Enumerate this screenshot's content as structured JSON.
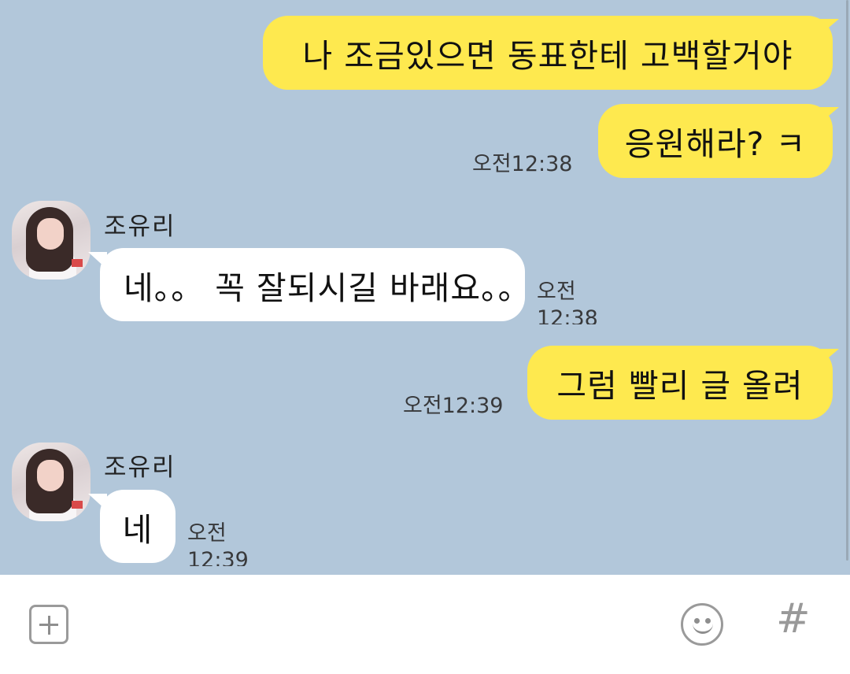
{
  "messages": [
    {
      "id": "m1",
      "from": "me",
      "text": "나 조금있으면 동표한테 고백할거야",
      "time": ""
    },
    {
      "id": "m2",
      "from": "me",
      "text": "응원해라? ㅋ",
      "time": "오전12:38"
    },
    {
      "id": "m3",
      "from": "other",
      "sender": "조유리",
      "text": "네。。 꼭 잘되시길 바래요。。",
      "time": "오전 12:38"
    },
    {
      "id": "m4",
      "from": "me",
      "text": "그럼 빨리 글 올려",
      "time": "오전12:39"
    },
    {
      "id": "m5",
      "from": "other",
      "sender": "조유리",
      "text": "네",
      "time": "오전 12:39"
    }
  ],
  "composer": {
    "add_icon": "plus-square-icon",
    "emoji_icon": "smiley-icon",
    "hash_icon": "hash-icon",
    "hash_label": "#"
  },
  "colors": {
    "background": "#b2c7da",
    "my_bubble": "#fee94f",
    "other_bubble": "#ffffff"
  }
}
